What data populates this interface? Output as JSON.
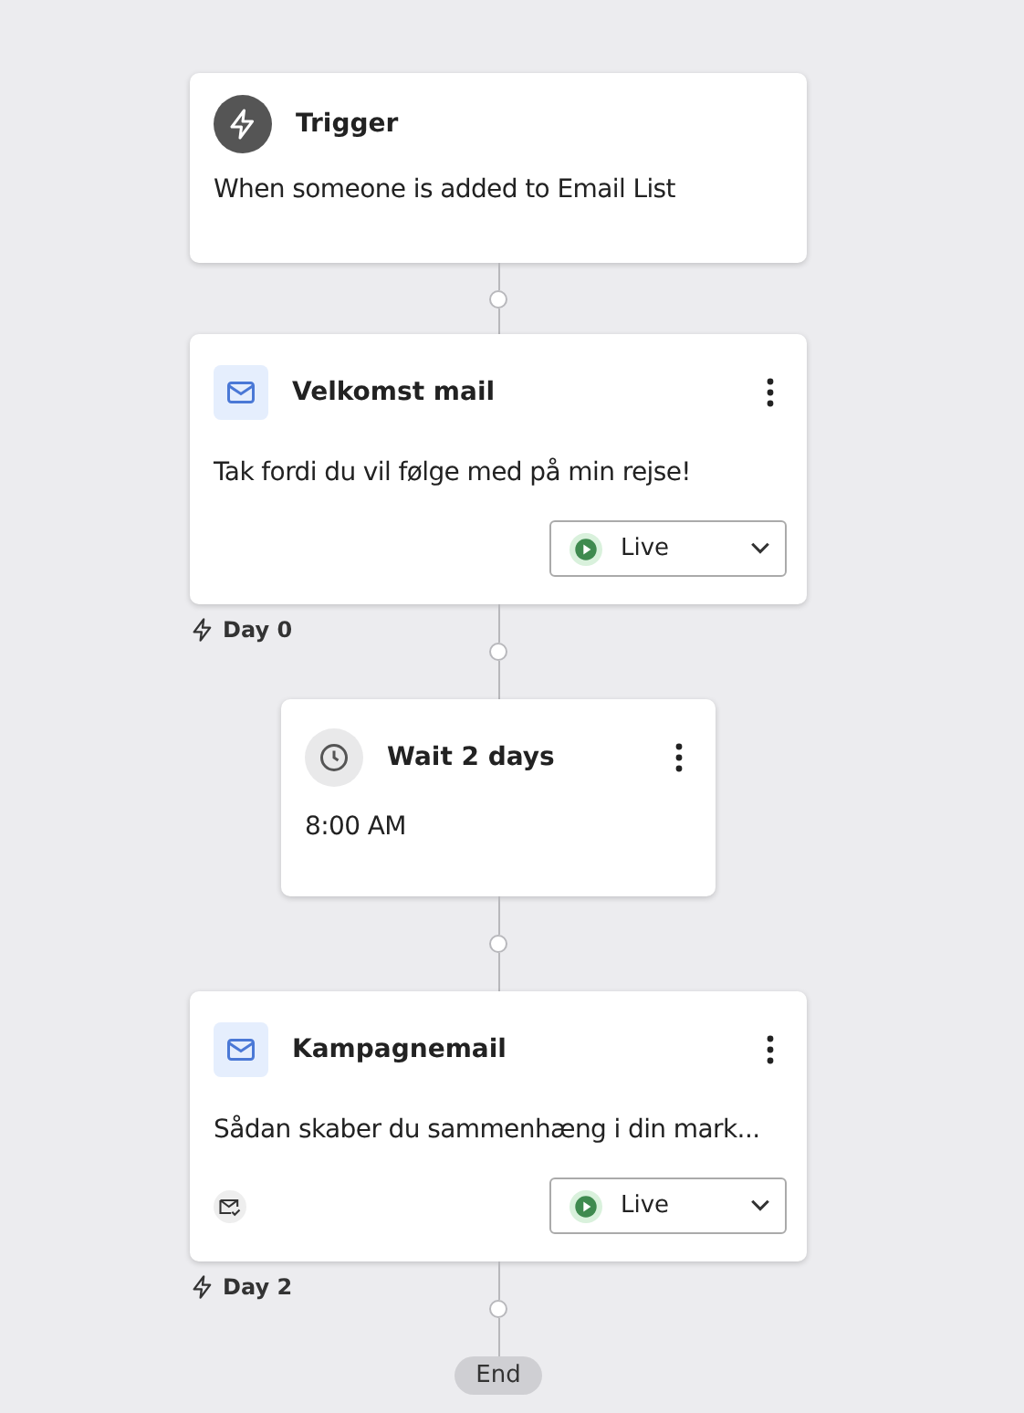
{
  "steps": [
    {
      "kind": "trigger",
      "title": "Trigger",
      "text": "When someone is added to Email List"
    },
    {
      "kind": "email",
      "title": "Velkomst mail",
      "text": "Tak fordi du vil følge med på min rejse!",
      "status": "Live",
      "live": true,
      "tracking": false,
      "day": "Day 0"
    },
    {
      "kind": "wait",
      "title": "Wait 2 days",
      "text": "8:00 AM"
    },
    {
      "kind": "email",
      "title": "Kampagnemail",
      "text": "Sådan skaber du sammenhæng i din mark...",
      "status": "Live",
      "live": true,
      "tracking": true,
      "day": "Day 2"
    }
  ],
  "end": "End"
}
